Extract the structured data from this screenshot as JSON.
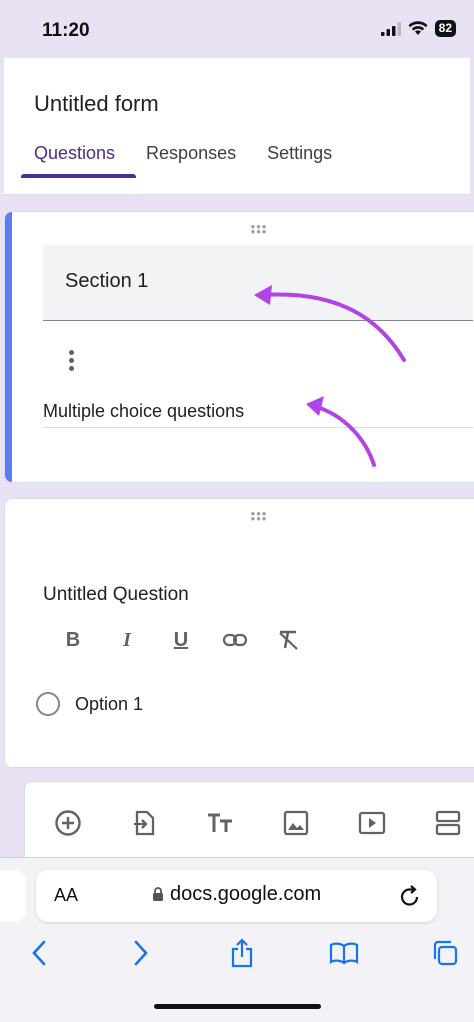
{
  "status": {
    "time": "11:20",
    "battery": "82"
  },
  "form": {
    "title": "Untitled form"
  },
  "tabs": [
    {
      "label": "Questions"
    },
    {
      "label": "Responses"
    },
    {
      "label": "Settings"
    }
  ],
  "section": {
    "title": "Section 1",
    "description": "Multiple choice questions"
  },
  "question": {
    "title": "Untitled Question",
    "option": "Option 1"
  },
  "browser": {
    "text_size": "AA",
    "url": "docs.google.com"
  },
  "colors": {
    "accent": "#4d2c91",
    "section_bar": "#5b7cf7",
    "arrow": "#b044e6"
  }
}
